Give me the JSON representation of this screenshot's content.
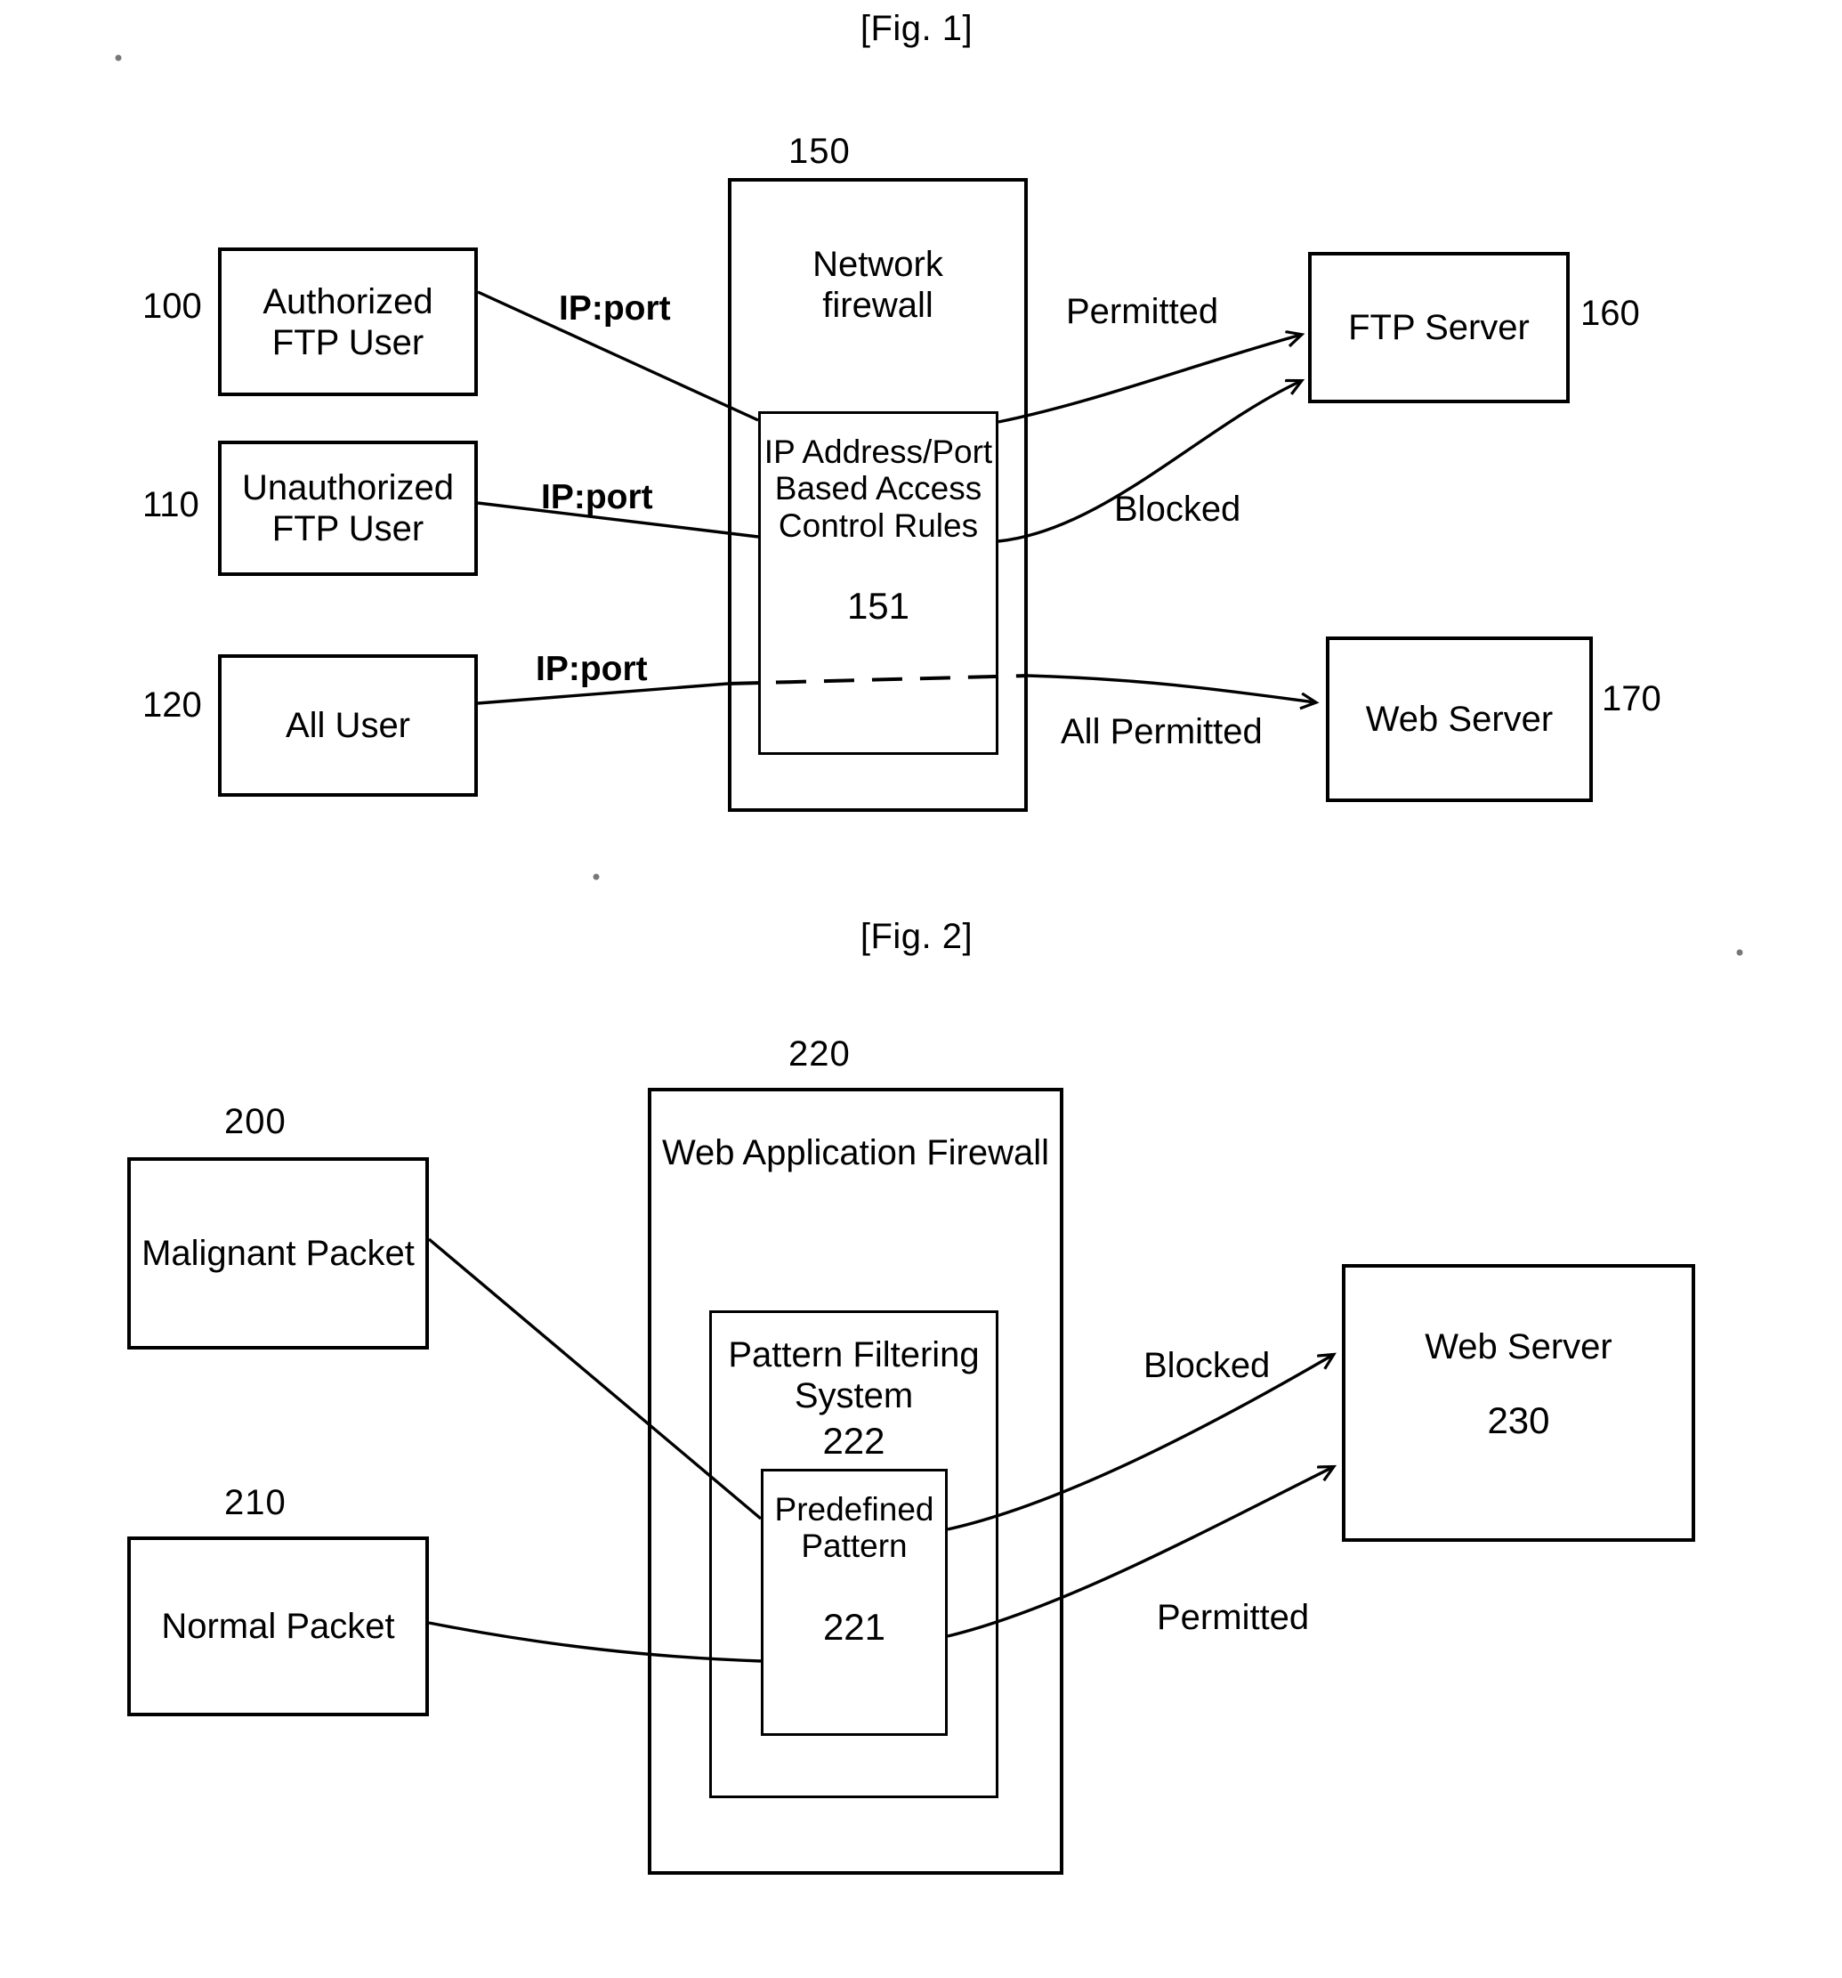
{
  "figures": [
    {
      "title": "[Fig. 1]",
      "refs": {
        "authorized_user": "100",
        "unauthorized_user": "110",
        "all_user": "120",
        "network_firewall": "150",
        "access_control_rules": "151",
        "ftp_server": "160",
        "web_server": "170"
      },
      "nodes": {
        "authorized_user": "Authorized\nFTP User",
        "unauthorized_user": "Unauthorized\nFTP User",
        "all_user": "All User",
        "network_firewall": "Network\nfirewall",
        "access_control_rules": "IP Address/Port\nBased Access\nControl Rules",
        "ftp_server": "FTP Server",
        "web_server": "Web Server"
      },
      "edge_labels": {
        "ipport_1": "IP:port",
        "ipport_2": "IP:port",
        "ipport_3": "IP:port",
        "permitted": "Permitted",
        "blocked": "Blocked",
        "all_permitted": "All Permitted"
      }
    },
    {
      "title": "[Fig. 2]",
      "refs": {
        "malignant_packet": "200",
        "normal_packet": "210",
        "web_application_firewall": "220",
        "predefined_pattern": "221",
        "pattern_filtering_system": "222",
        "web_server": "230"
      },
      "nodes": {
        "malignant_packet": "Malignant Packet",
        "normal_packet": "Normal Packet",
        "web_application_firewall": "Web Application Firewall",
        "pattern_filtering_system": "Pattern Filtering\nSystem",
        "predefined_pattern": "Predefined\nPattern",
        "web_server": "Web Server"
      },
      "edge_labels": {
        "blocked": "Blocked",
        "permitted": "Permitted"
      }
    }
  ],
  "colors": {
    "ink": "#000000",
    "paper": "#ffffff"
  }
}
